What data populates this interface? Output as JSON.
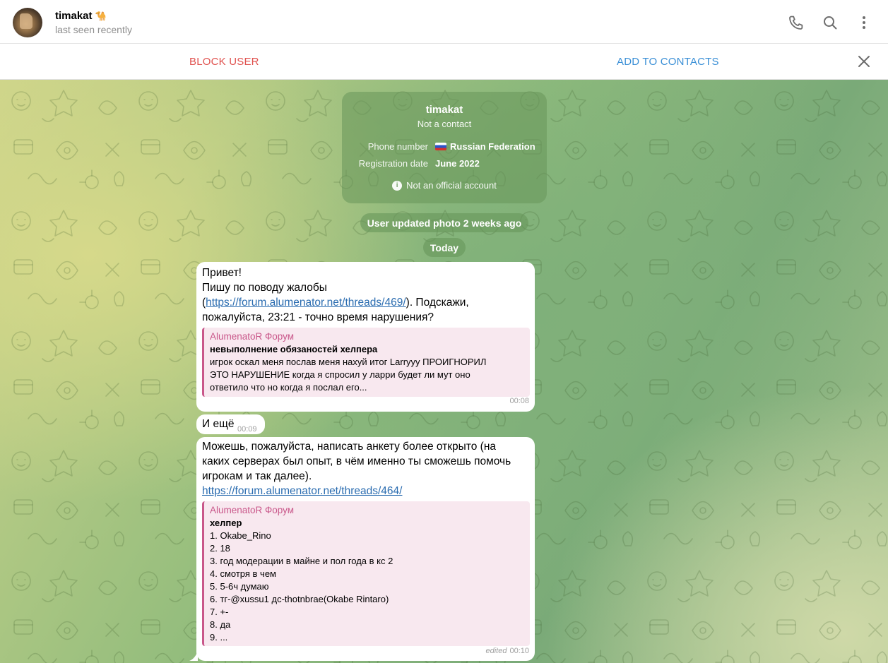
{
  "header": {
    "name": "timakat",
    "name_emoji": "🐪",
    "status": "last seen recently",
    "icons": [
      "phone-icon",
      "search-icon",
      "more-vertical-icon"
    ]
  },
  "action_bar": {
    "block_label": "BLOCK USER",
    "add_label": "ADD TO CONTACTS",
    "close_icon": "close-icon"
  },
  "info_card": {
    "name": "timakat",
    "subtitle": "Not a contact",
    "phone_label": "Phone number",
    "phone_value": "Russian Federation",
    "reg_label": "Registration date",
    "reg_value": "June 2022",
    "official_note": "Not an official account"
  },
  "service": {
    "photo_update": "User updated photo 2 weeks ago",
    "date": "Today"
  },
  "messages": [
    {
      "line1": "Привет!",
      "line2": "Пишу по поводу жалобы",
      "open_paren": "(",
      "link": "https://forum.alumenator.net/threads/469/",
      "after_link": "). Подскажи,",
      "line4": "пожалуйста, 23:21 - точно время нарушения?",
      "preview": {
        "source": "AlumenatoR Форум",
        "title": "невыполнение обязаностей хелпера",
        "lines": [
          "игрок оскал меня послав меня нахуй итог Larryyy ПРОИГНОРИЛ",
          "ЭТО НАРУШЕНИЕ  когда я спросил у ларри будет ли мут оно",
          "ответило что  но когда я послал его..."
        ]
      },
      "time": "00:08"
    },
    {
      "text": "И ещё",
      "time": "00:09"
    },
    {
      "lines": [
        "Можешь, пожалуйста, написать анкету более открыто (на",
        "каких серверах был опыт, в чём именно ты сможешь помочь",
        "игрокам и так далее)."
      ],
      "link": "https://forum.alumenator.net/threads/464/",
      "preview": {
        "source": "AlumenatoR Форум",
        "title": "хелпер",
        "lines": [
          "1. Okabe_Rino",
          "2. 18",
          "3. год модерации в майне и пол года в кс 2",
          "4. смотря в чем",
          "5. 5-6ч думаю",
          "6. тг-@xussu1 дс-thotnbrae(Okabe Rintaro)",
          "7. +-",
          "8. да",
          "9. ..."
        ]
      },
      "edited": "edited",
      "time": "00:10"
    }
  ]
}
